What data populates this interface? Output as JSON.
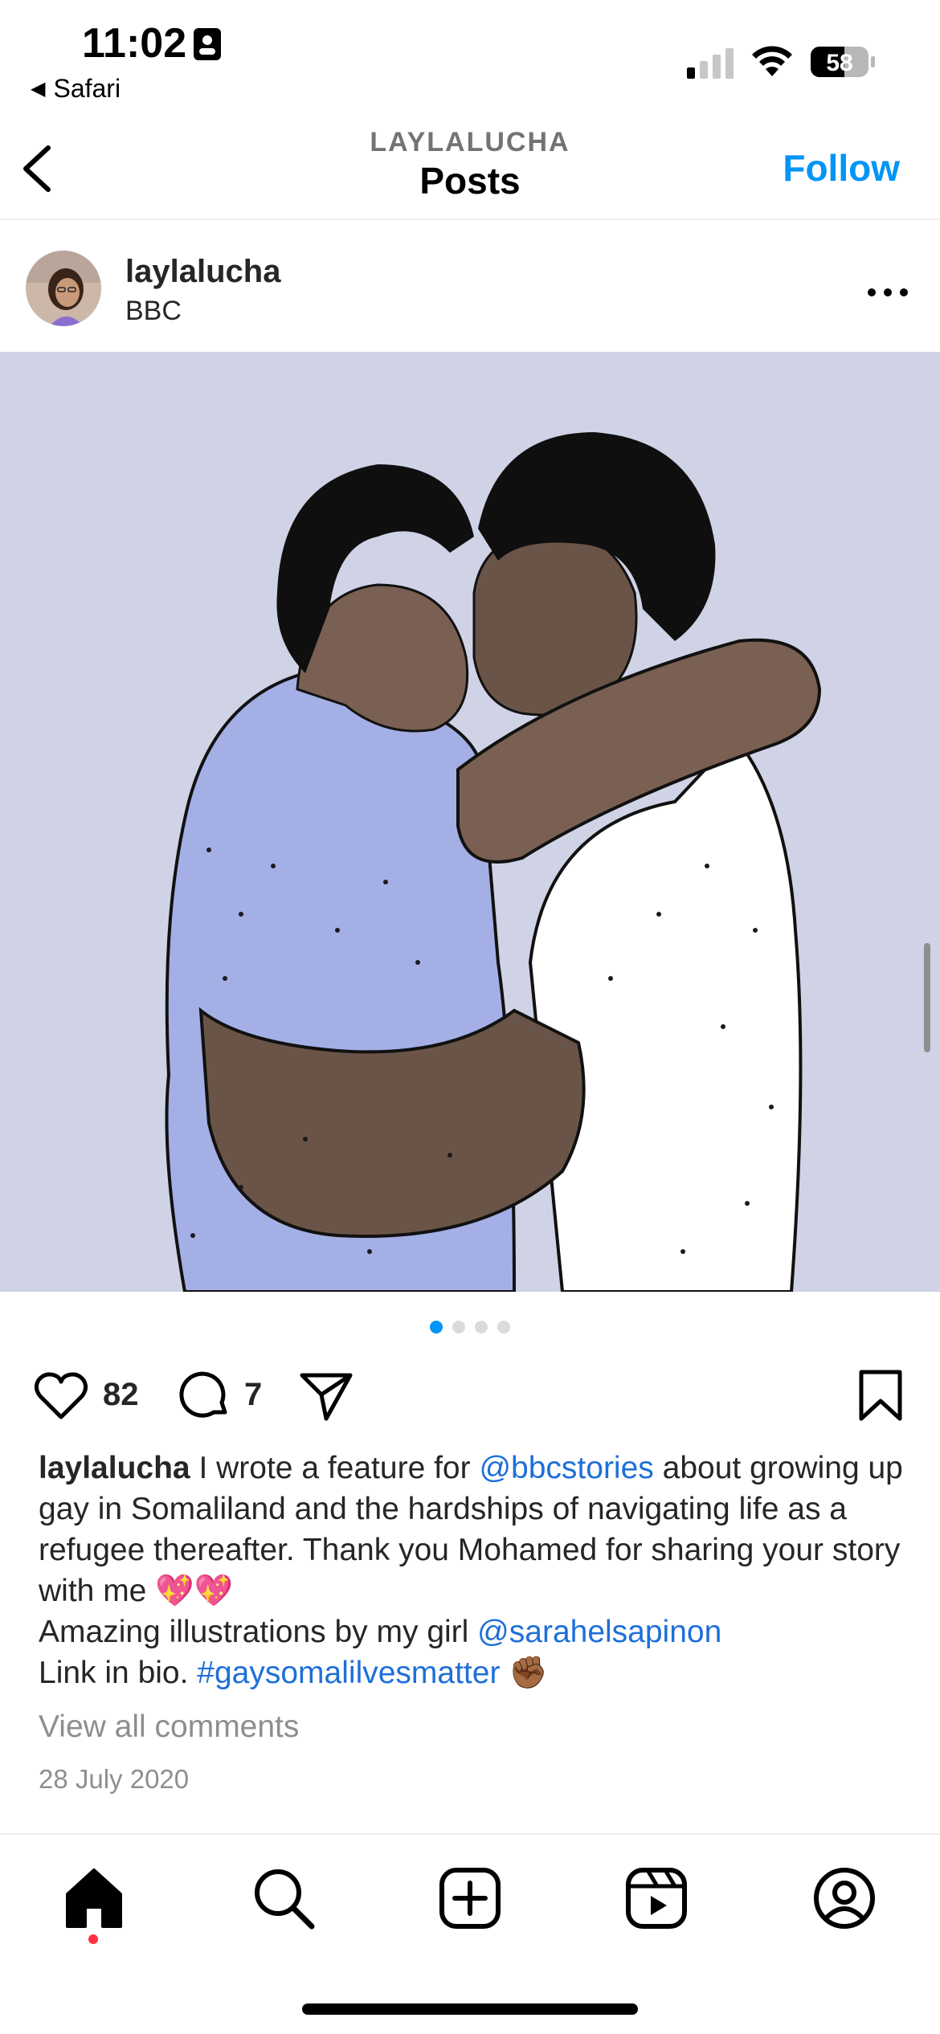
{
  "status_bar": {
    "time": "11:02",
    "back_app": "Safari",
    "battery": "58"
  },
  "nav": {
    "subtitle": "LAYLALUCHA",
    "title": "Posts",
    "follow": "Follow"
  },
  "post": {
    "username": "laylalucha",
    "location": "BBC",
    "carousel": {
      "total": 4,
      "active": 1
    },
    "likes": "82",
    "comments": "7",
    "caption": {
      "user": "laylalucha",
      "t1": " I wrote a feature for ",
      "m1": "@bbcstories",
      "t2": " about growing up gay in Somaliland and the hardships of navigating life as a refugee thereafter. Thank you Mohamed for sharing your story with me 💖💖",
      "t3": "Amazing illustrations by my girl ",
      "m2": "@sarahelsapinon",
      "t4": "Link in bio. ",
      "hashtag": "#gaysomalilvesmatter",
      "t5": " ✊🏾"
    },
    "view_comments": "View all comments",
    "date": "28 July 2020"
  },
  "colors": {
    "accent": "#0095f6",
    "link": "#1e6fd9",
    "muted": "#8e8e8e",
    "image_bg": "#d0d2e6",
    "notification": "#ff3040"
  },
  "tabbar": {
    "icons": [
      "home-icon",
      "search-icon",
      "new-post-icon",
      "reels-icon",
      "profile-icon"
    ]
  }
}
